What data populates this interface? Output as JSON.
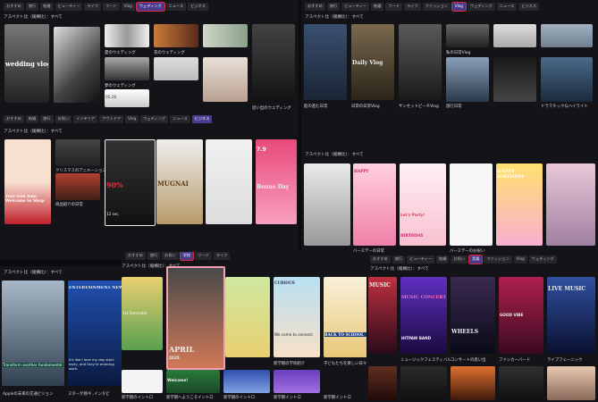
{
  "panel_a": {
    "ratio": "アスペクト比（縦横比）：すべて",
    "tabs": [
      "おすすめ",
      "旅行",
      "結婚",
      "ビューティー",
      "ライフ",
      "フード",
      "Vlog",
      "ウェディング",
      "ニュース",
      "ビジネス"
    ],
    "captions": [
      "",
      "",
      "夏のウェディング",
      "",
      "",
      "花のウェディング",
      "夢のウェディング",
      "思い出のウェディング"
    ],
    "thumb_text": {
      "vlog": "wedding vlog",
      "date": "05.28"
    }
  },
  "panel_b": {
    "ratio": "アスペクト比（縦横比）：すべて",
    "tabs": [
      "おすすめ",
      "旅行",
      "ビューティー",
      "結婚",
      "フード",
      "ライフ",
      "ファッション",
      "Vlog",
      "ウェディング",
      "ニュース",
      "ビジネス"
    ],
    "captions": [
      "",
      "",
      "",
      "",
      "私の日常Vlog",
      "",
      "",
      "",
      "",
      "",
      "船の進む日常",
      "日常の日常Vlog",
      "サンセットビーチVlog",
      "旅行日常",
      "",
      "ドラマチックなハイライト"
    ],
    "thumb_text": {
      "daily": "Daily Vlog"
    }
  },
  "panel_c": {
    "ratio": "アスペクト比（縦横比）：すべて",
    "tabs": [
      "おすすめ",
      "結婚",
      "旅行",
      "お祝い",
      "インテリア",
      "アウトドア",
      "Vlog",
      "ウェディング",
      "ニュース",
      "ビジネス"
    ],
    "captions": [
      "",
      "",
      "",
      "クリスマスのアニメーション",
      "商品紹介の日常",
      "",
      "",
      "バーサーのポップ",
      "",
      "",
      ""
    ],
    "thumb_text": {
      "shop": "Year-End Sale Welcome to Shop",
      "price": "12 sec",
      "percent": "90%",
      "mugnai": "MUGNAI",
      "day": "Bonne Day",
      "num": "7.9"
    }
  },
  "panel_d": {
    "ratio": "アスペクト比（縦横比）：すべて",
    "tabs": [
      "おすすめ",
      "旅行",
      "お祝い",
      "お誕生日",
      "インテリア",
      "アウトドア",
      "Vlog",
      "ウェディング",
      "ニュース",
      "ビジネス"
    ],
    "captions": [
      "",
      "",
      "",
      "バースデーの日常",
      "",
      "バースデーのお祝い"
    ],
    "thumb_text": {
      "happy": "HAPPY",
      "party": "Let's Party!",
      "birthday": "BIRTHDAY",
      "happy2": "HAPPY BIRTHDAY"
    }
  },
  "panel_e": {
    "ratio": "アスペクト比（縦横比）：すべて",
    "captions": [
      "Appleの未来の交通ビジョン",
      "スターが熱ギ..インタビ"
    ],
    "thumb_text": {
      "news": "ENTERTAINMENT NEWS",
      "quote": "It's like I love my day start early, and they're entering work.",
      "tag": "Transform another fundamental"
    }
  },
  "panel_f": {
    "ratio": "アスペクト比（縦横比）：すべて",
    "tabs": [
      "おすすめ",
      "旅行",
      "お祝い",
      "学校",
      "フード",
      "ライフ"
    ],
    "captions": [
      "新学期のイントロ",
      "新学期へようこそイントロ",
      "新学期のイントロ",
      "新学期の学校紹介",
      "子どもたちを楽しい日々",
      "",
      "新学期イントロ",
      "新学期イントロ"
    ],
    "thumb_text": {
      "school": "BACK TO SCHOOL",
      "welcome": "Welcome!",
      "april": "APRIL",
      "year": "2025",
      "curious": "CURIOUS",
      "connect": "We come to connect",
      "first": "1st Semester"
    }
  },
  "panel_g": {
    "ratio": "アスペクト比（縦横比）：すべて",
    "tabs": [
      "おすすめ",
      "旅行",
      "ビューティー",
      "結婚",
      "お祝い",
      "音楽",
      "ファッション",
      "Vlog",
      "ウェディング",
      "ニュース",
      "ビジネス"
    ],
    "captions": [
      "ミュージックフェスティバル",
      "コンサートの思い出",
      "ファンカーバード",
      "ライブフェーニック"
    ],
    "thumb_text": {
      "music": "MUSIC",
      "concert": "MUSIC CONCERT",
      "band": "HITPAW BAND",
      "wheels": "WHEELS",
      "live": "LIVE MUSIC",
      "good": "GOOD VIBE",
      "music2": "MUSIC"
    }
  }
}
